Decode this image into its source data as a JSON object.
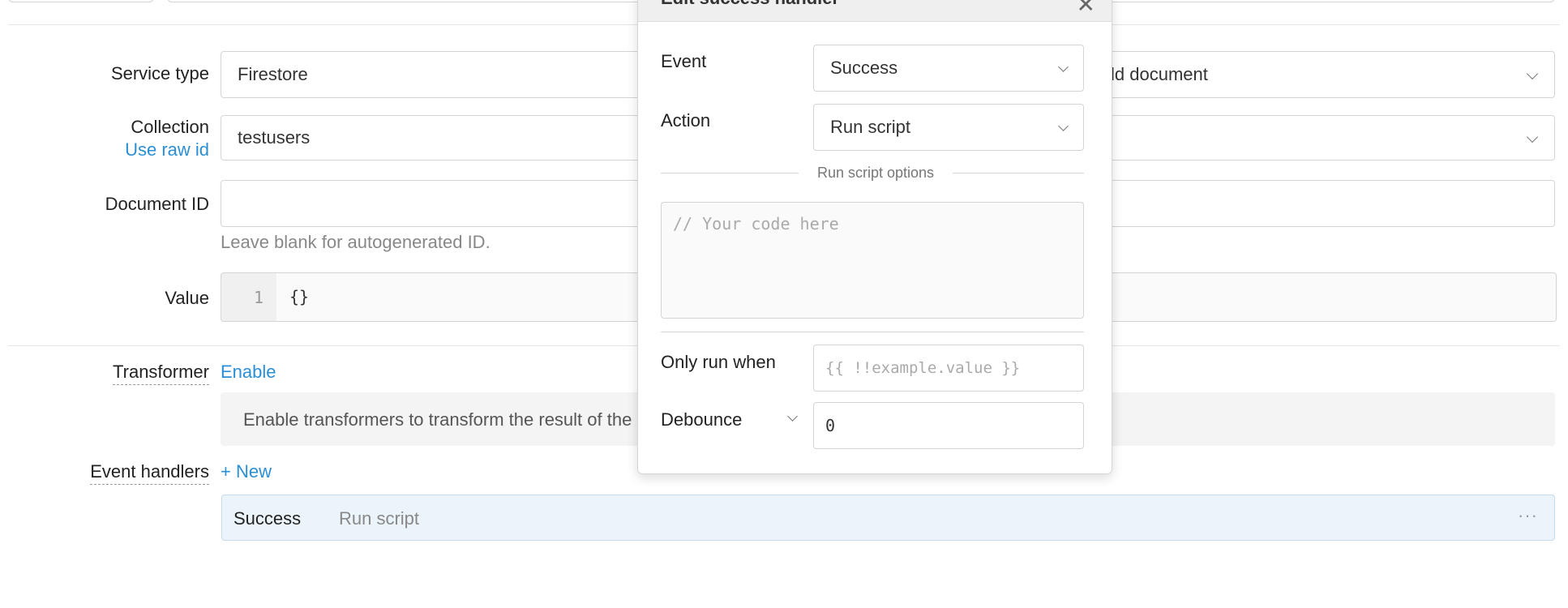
{
  "header": {
    "modal_title": "Edit success handler"
  },
  "form": {
    "service_type": {
      "label": "Service type",
      "value": "Firestore"
    },
    "action_type": {
      "value": "Add document"
    },
    "collection": {
      "label": "Collection",
      "link": "Use raw id",
      "value": "testusers"
    },
    "document_id": {
      "label": "Document ID",
      "value": "",
      "helper": "Leave blank for autogenerated ID."
    },
    "value": {
      "label": "Value",
      "line_number": "1",
      "code": "{}"
    },
    "transformer": {
      "label": "Transformer",
      "link": "Enable",
      "info": "Enable transformers to transform the result of the query."
    },
    "event_handlers": {
      "label": "Event handlers",
      "new_label": "+ New",
      "rows": [
        {
          "event": "Success",
          "action": "Run script",
          "menu": "···"
        }
      ]
    }
  },
  "modal": {
    "event": {
      "label": "Event",
      "value": "Success"
    },
    "action": {
      "label": "Action",
      "value": "Run script"
    },
    "section_title": "Run script options",
    "code_placeholder": "// Your code here",
    "only_run_when": {
      "label": "Only run when",
      "placeholder": "{{ !!example.value }}"
    },
    "debounce": {
      "label": "Debounce",
      "value": "0"
    },
    "close_icon": "close-icon"
  }
}
